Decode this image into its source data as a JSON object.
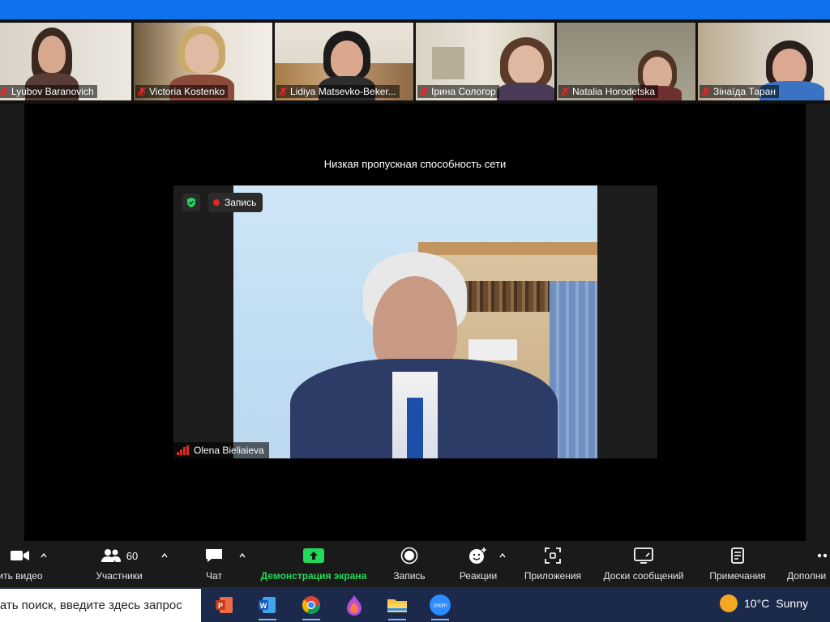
{
  "participants": [
    {
      "name": "Lyubov Baranovich",
      "muted": true
    },
    {
      "name": "Victoria Kostenko",
      "muted": true
    },
    {
      "name": "Lidiya Matsevko-Beker...",
      "muted": true
    },
    {
      "name": "Ірина Сологор",
      "muted": true
    },
    {
      "name": "Natalia Horodetska",
      "muted": true
    },
    {
      "name": "Зінаїда Таран",
      "muted": true
    }
  ],
  "network_notice": "Низкая пропускная способность сети",
  "recording_label": "Запись",
  "active_speaker": "Olena Bieliaieva",
  "toolbar": {
    "video": "ить видео",
    "participants": "Участники",
    "participants_count": "60",
    "chat": "Чат",
    "share": "Демонстрация экрана",
    "record": "Запись",
    "reactions": "Реакции",
    "apps": "Приложения",
    "whiteboards": "Доски сообщений",
    "notes": "Примечания",
    "more": "Дополни"
  },
  "taskbar": {
    "search_placeholder": "чать поиск, введите здесь запрос",
    "apps": [
      "powerpoint-icon",
      "word-icon",
      "chrome-icon",
      "paint-drop-icon",
      "file-explorer-icon",
      "zoom-icon"
    ],
    "weather_temp": "10°C",
    "weather_text": "Sunny"
  },
  "colors": {
    "zoom_blue": "#0e72ed",
    "share_green": "#23d959",
    "muted_red": "#e02828",
    "record_red": "#e02828"
  }
}
